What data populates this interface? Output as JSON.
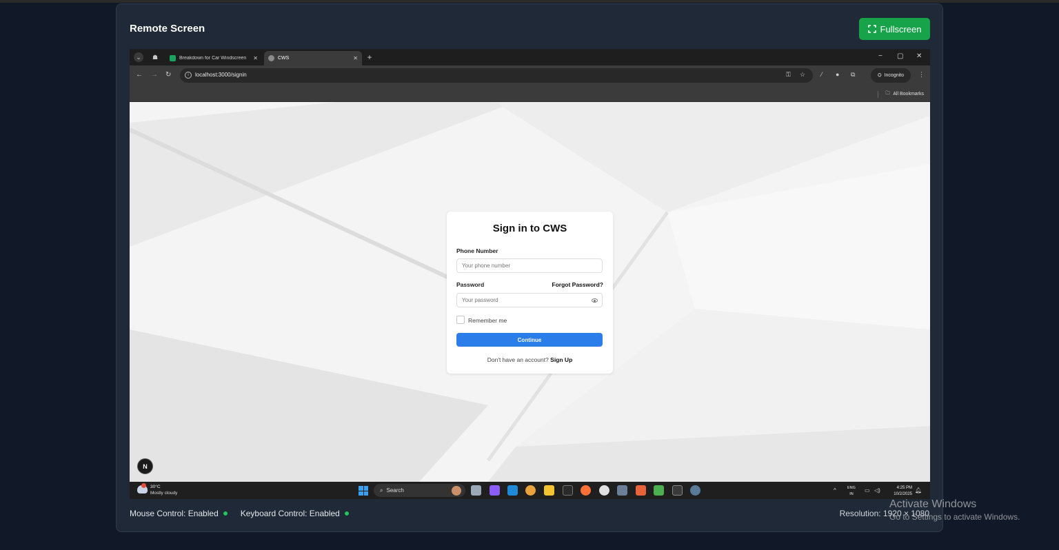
{
  "panel": {
    "title": "Remote Screen",
    "fullscreen_label": "Fullscreen"
  },
  "browser": {
    "tabs": [
      {
        "title": "Breakdown for Car Windscreen"
      },
      {
        "title": "CWS"
      }
    ],
    "url": "localhost:3000/signin",
    "incognito_label": "Incognito",
    "bookmarks_label": "All Bookmarks"
  },
  "signin": {
    "title": "Sign in to CWS",
    "phone_label": "Phone Number",
    "phone_placeholder": "Your phone number",
    "password_label": "Password",
    "forgot_label": "Forgot Password?",
    "password_placeholder": "Your password",
    "remember_label": "Remember me",
    "continue_label": "Continue",
    "no_account_text": "Don't have an account?",
    "signup_label": "Sign Up",
    "badge_letter": "N"
  },
  "taskbar": {
    "weather_temp": "30°C",
    "weather_desc": "Mostly cloudy",
    "search_label": "Search",
    "lang_line1": "ENG",
    "lang_line2": "IN",
    "time": "4:25 PM",
    "date": "10/2/2025"
  },
  "status": {
    "mouse": "Mouse Control: Enabled",
    "keyboard": "Keyboard Control: Enabled",
    "resolution": "Resolution: 1920 × 1080"
  },
  "watermark": {
    "line1": "Activate Windows",
    "line2": "Go to Settings to activate Windows."
  },
  "colors": {
    "background": "#111827",
    "panel": "#1f2937",
    "fullscreen_button": "#16a34a",
    "continue_button": "#2b7de9",
    "status_dot": "#22c55e"
  }
}
